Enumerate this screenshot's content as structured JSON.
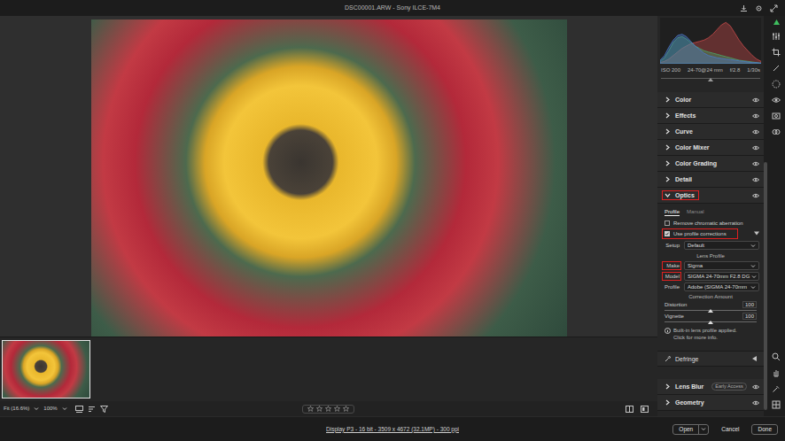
{
  "window": {
    "title": "DSC00001.ARW - Sony ILCE-7M4"
  },
  "histogram": {
    "series": [
      {
        "name": "Red",
        "color": "#c84a4a",
        "values": [
          2,
          4,
          8,
          14,
          20,
          26,
          30,
          34,
          36,
          38,
          40,
          44,
          50,
          58,
          66,
          70,
          64,
          52,
          40,
          30,
          22,
          14,
          8,
          4
        ]
      },
      {
        "name": "Green",
        "color": "#4aa86a",
        "values": [
          4,
          10,
          22,
          36,
          44,
          46,
          42,
          36,
          30,
          26,
          22,
          20,
          18,
          16,
          14,
          12,
          10,
          8,
          6,
          5,
          4,
          3,
          2,
          1
        ]
      },
      {
        "name": "Blue",
        "color": "#4a78c8",
        "values": [
          6,
          14,
          28,
          40,
          48,
          50,
          46,
          38,
          30,
          24,
          18,
          14,
          12,
          10,
          9,
          8,
          7,
          6,
          5,
          4,
          3,
          2,
          2,
          1
        ]
      }
    ]
  },
  "exif": [
    "ISO 200",
    "24-70@24 mm",
    "f/2.8",
    "1/30s"
  ],
  "sections": [
    {
      "label": "Color",
      "expanded": false,
      "highlighted": false
    },
    {
      "label": "Effects",
      "expanded": false,
      "highlighted": false
    },
    {
      "label": "Curve",
      "expanded": false,
      "highlighted": false
    },
    {
      "label": "Color Mixer",
      "expanded": false,
      "highlighted": false
    },
    {
      "label": "Color Grading",
      "expanded": false,
      "highlighted": false
    },
    {
      "label": "Detail",
      "expanded": false,
      "highlighted": false
    }
  ],
  "optics": {
    "label": "Optics",
    "expanded": true,
    "highlighted": true,
    "tabs": [
      {
        "label": "Profile",
        "selected": true
      },
      {
        "label": "Manual",
        "selected": false
      }
    ],
    "checkboxes": [
      {
        "label": "Remove chromatic aberration",
        "checked": false,
        "highlighted": false
      },
      {
        "label": "Use profile corrections",
        "checked": true,
        "highlighted": true
      }
    ],
    "setup": {
      "label": "Setup",
      "value": "Default"
    },
    "lens_profile": {
      "title": "Lens Profile",
      "fields": [
        {
          "label": "Make",
          "value": "Sigma",
          "highlighted": true
        },
        {
          "label": "Model",
          "value": "SIGMA 24-70mm F2.8 DG",
          "highlighted": true
        },
        {
          "label": "Profile",
          "value": "Adobe (SIGMA 24-70mm",
          "highlighted": false
        }
      ]
    },
    "correction": {
      "title": "Correction Amount",
      "sliders": [
        {
          "label": "Distortion",
          "value": "100",
          "level": 0.5
        },
        {
          "label": "Vignette",
          "value": "100",
          "level": 0.5
        }
      ]
    },
    "note": "Built-in lens profile applied. Click for more info.",
    "defringe": {
      "label": "Defringe",
      "expanded": false
    }
  },
  "lower_sections": [
    {
      "label": "Lens Blur",
      "badge": "Early Access",
      "expanded": false,
      "highlighted": false
    },
    {
      "label": "Geometry",
      "expanded": false,
      "highlighted": false
    }
  ],
  "filmstrip": [
    {
      "selected": true
    }
  ],
  "toolbar": {
    "zoom": "Fit (16.6%)",
    "zoom_preset": "100%",
    "rating": {
      "stars": 0
    }
  },
  "footer": {
    "info": "Display P3 - 16 bit - 3509 x 4672 (32.1MP) - 300 ppi",
    "buttons": [
      {
        "label": "Open",
        "kind": "split"
      },
      {
        "label": "Cancel",
        "kind": "plain"
      },
      {
        "label": "Done",
        "kind": "boxed"
      }
    ]
  }
}
